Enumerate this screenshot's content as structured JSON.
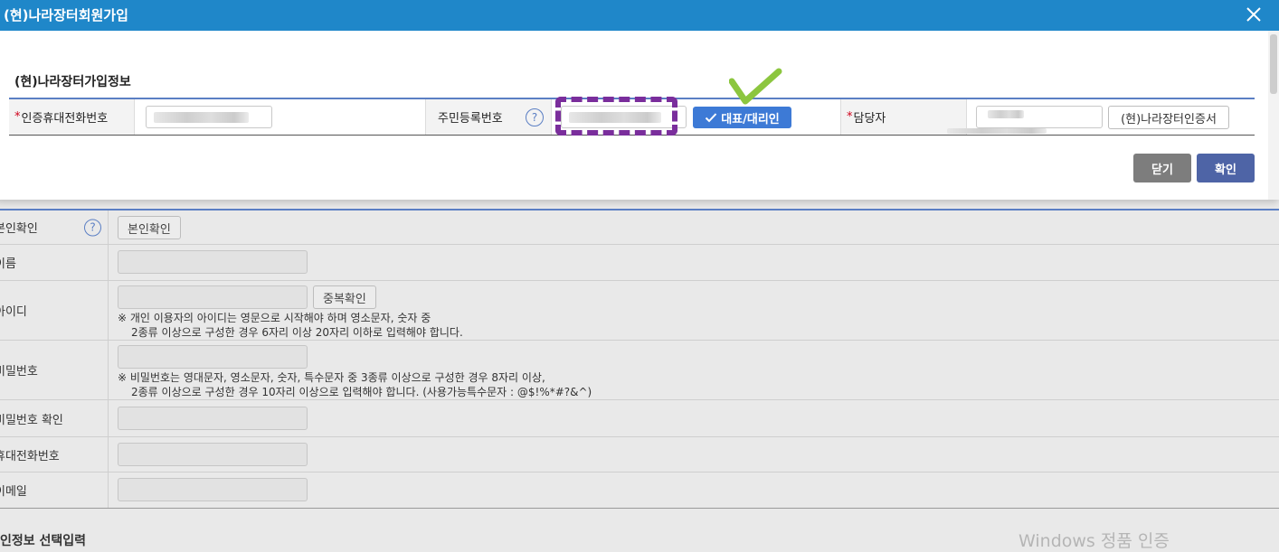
{
  "modal": {
    "title": "(현)나라장터회원가입",
    "section_title": "(현)나라장터가입정보",
    "fields": {
      "phone_label": "인증휴대전화번호",
      "rrn_label": "주민등록번호",
      "manager_label": "담당자",
      "required_mark": "*",
      "help_glyph": "?"
    },
    "buttons": {
      "representative": "대표/대리인",
      "certificate": "(현)나라장터인증서",
      "close": "닫기",
      "confirm": "확인"
    }
  },
  "background_form": {
    "rows": {
      "identity_label": "본인확인",
      "identity_button": "본인확인",
      "name_label": "이름",
      "id_label": "아이디",
      "id_check_button": "중복확인",
      "id_note_1": "※ 개인 이용자의 아이디는 영문으로 시작해야 하며 영소문자, 숫자 중",
      "id_note_2": "2종류 이상으로 구성한 경우 6자리 이상 20자리 이하로 입력해야 합니다.",
      "password_label": "비밀번호",
      "password_note_1": "※ 비밀번호는 영대문자, 영소문자, 숫자, 특수문자 중 3종류 이상으로 구성한 경우 8자리 이상,",
      "password_note_2": "2종류 이상으로 구성한 경우 10자리 이상으로 입력해야 합니다. (사용가능특수문자 : @$!%*#?&^)",
      "password_confirm_label": "비밀번호 확인",
      "mobile_label": "휴대전화번호",
      "email_label": "이메일"
    },
    "next_section_title": "인정보 선택입력"
  },
  "watermark": "Windows 정품 인증",
  "colors": {
    "header": "#1f87c9",
    "accent": "#5b7fc4",
    "primary_button": "#4e64a6",
    "representative_button": "#3d7ad6",
    "annotation_dash": "#7a2e9c",
    "annotation_check": "#8cc63f"
  }
}
